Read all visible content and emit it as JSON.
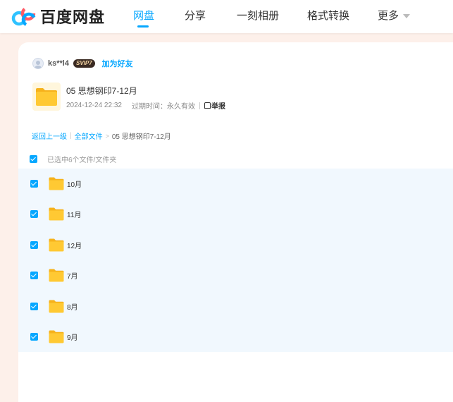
{
  "header": {
    "logo_text": "百度网盘",
    "nav": [
      {
        "label": "网盘",
        "active": true
      },
      {
        "label": "分享",
        "active": false
      },
      {
        "label": "一刻相册",
        "active": false
      },
      {
        "label": "格式转换",
        "active": false
      },
      {
        "label": "更多",
        "active": false
      }
    ]
  },
  "owner": {
    "username": "ks**l4",
    "badge": "SVIP7",
    "add_friend": "加为好友"
  },
  "share": {
    "title": "05 思想钢印7-12月",
    "date": "2024-12-24 22:32",
    "expiry": "过期时间：永久有效",
    "report": "举报"
  },
  "breadcrumb": {
    "back": "返回上一级",
    "all_files": "全部文件",
    "current": "05 思想钢印7-12月"
  },
  "selection": {
    "label": "已选中6个文件/文件夹"
  },
  "files": [
    {
      "name": "10月"
    },
    {
      "name": "11月"
    },
    {
      "name": "12月"
    },
    {
      "name": "7月"
    },
    {
      "name": "8月"
    },
    {
      "name": "9月"
    }
  ],
  "colors": {
    "accent": "#06a7ff",
    "page_bg": "#fdf0ea",
    "list_bg": "#f1f8fe",
    "folder": "#ffc933"
  }
}
